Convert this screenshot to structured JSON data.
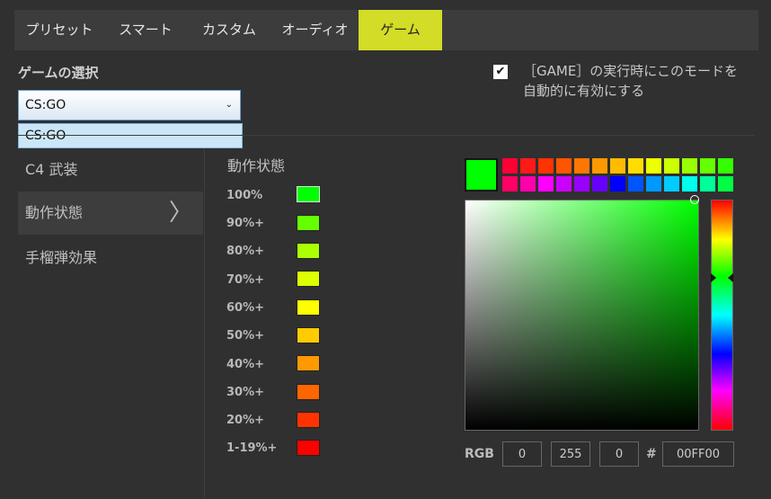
{
  "tabs": [
    {
      "label": "プリセット",
      "active": false
    },
    {
      "label": "スマート",
      "active": false
    },
    {
      "label": "カスタム",
      "active": false
    },
    {
      "label": "オーディオ",
      "active": false
    },
    {
      "label": "ゲーム",
      "active": true
    }
  ],
  "game_select": {
    "label": "ゲームの選択",
    "value": "CS:GO",
    "options": [
      "CS:GO"
    ]
  },
  "auto_enable": {
    "checked": true,
    "check_glyph": "✔",
    "text": "［GAME］の実行時にこのモードを自動的に有効にする"
  },
  "nav": {
    "items": [
      {
        "label": "C4 武装",
        "active": false
      },
      {
        "label": "動作状態",
        "active": true
      },
      {
        "label": "手榴弾効果",
        "active": false
      }
    ],
    "arrow_glyph": "〉"
  },
  "status_section": {
    "title": "動作状態",
    "levels": [
      {
        "label": "100%",
        "color": "#00ff00"
      },
      {
        "label": "90%+",
        "color": "#66ff00"
      },
      {
        "label": "80%+",
        "color": "#aaff00"
      },
      {
        "label": "70%+",
        "color": "#ddff00"
      },
      {
        "label": "60%+",
        "color": "#ffff00"
      },
      {
        "label": "50%+",
        "color": "#ffcc00"
      },
      {
        "label": "40%+",
        "color": "#ff9900"
      },
      {
        "label": "30%+",
        "color": "#ff6600"
      },
      {
        "label": "20%+",
        "color": "#ff3300"
      },
      {
        "label": "1-19%+",
        "color": "#ff0000"
      }
    ]
  },
  "color_picker": {
    "current_color": "#00ff00",
    "palette_row1": [
      "#ff0033",
      "#ff1a1a",
      "#ff3300",
      "#ff5500",
      "#ff7700",
      "#ff9900",
      "#ffbb00",
      "#ffdd00",
      "#eeff00",
      "#ccff00",
      "#99ff00",
      "#66ff00",
      "#33ff00"
    ],
    "palette_row2": [
      "#ff0066",
      "#ff00aa",
      "#ff00ff",
      "#cc00ff",
      "#9900ff",
      "#6600ff",
      "#0000ff",
      "#0055ff",
      "#0099ff",
      "#00ccff",
      "#00ffee",
      "#00ff99",
      "#00ff44"
    ],
    "rgb_label": "RGB",
    "r": "0",
    "g": "255",
    "b": "0",
    "hash_label": "#",
    "hex": "00FF00"
  }
}
